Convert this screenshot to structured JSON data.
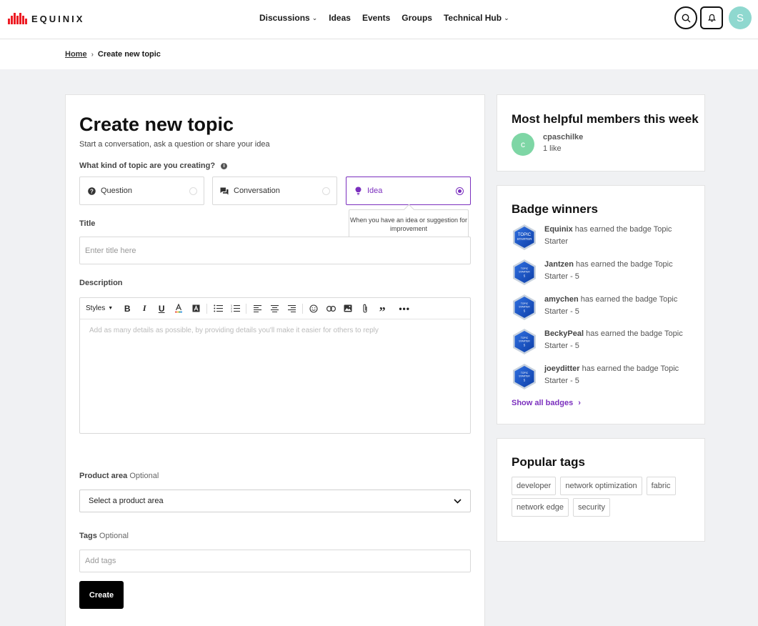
{
  "brand": {
    "name": "EQUINIX",
    "accent": "#ed1c24"
  },
  "nav": [
    {
      "label": "Discussions",
      "has_menu": true
    },
    {
      "label": "Ideas",
      "has_menu": false
    },
    {
      "label": "Events",
      "has_menu": false
    },
    {
      "label": "Groups",
      "has_menu": false
    },
    {
      "label": "Technical Hub",
      "has_menu": true
    }
  ],
  "header": {
    "avatar_initial": "S"
  },
  "breadcrumb": {
    "home": "Home",
    "current": "Create new topic"
  },
  "form": {
    "title": "Create new topic",
    "subtitle": "Start a conversation, ask a question or share your idea",
    "kind_label": "What kind of topic are you creating?",
    "kinds": [
      {
        "label": "Question",
        "icon": "question-circle-icon",
        "selected": false
      },
      {
        "label": "Conversation",
        "icon": "chat-bubbles-icon",
        "selected": false
      },
      {
        "label": "Idea",
        "icon": "lightbulb-icon",
        "selected": true
      }
    ],
    "idea_tooltip": "When you have an idea or suggestion for improvement",
    "title_label": "Title",
    "title_placeholder": "Enter title here",
    "description_label": "Description",
    "styles_label": "Styles",
    "description_placeholder": "Add as many details as possible, by providing details you'll make it easier for others to reply",
    "product_area_label": "Product area",
    "product_area_optional": "Optional",
    "product_area_value": "Select a product area",
    "tags_label": "Tags",
    "tags_optional": "Optional",
    "tags_placeholder": "Add tags",
    "create_label": "Create",
    "accent": "#7b2fbe"
  },
  "helpful": {
    "title": "Most helpful members this week",
    "member": {
      "initial": "c",
      "name": "cpaschilke",
      "likes": "1 like"
    }
  },
  "badges": {
    "title": "Badge winners",
    "earned_text": "has earned the badge",
    "winners": [
      {
        "user": "Equinix",
        "badge": "Topic Starter"
      },
      {
        "user": "Jantzen",
        "badge": "Topic Starter - 5"
      },
      {
        "user": "amychen",
        "badge": "Topic Starter - 5"
      },
      {
        "user": "BeckyPeal",
        "badge": "Topic Starter - 5"
      },
      {
        "user": "joeyditter",
        "badge": "Topic Starter - 5"
      }
    ],
    "show_all": "Show all badges"
  },
  "popular_tags": {
    "title": "Popular tags",
    "tags": [
      "developer",
      "network optimization",
      "fabric",
      "network edge",
      "security"
    ]
  }
}
